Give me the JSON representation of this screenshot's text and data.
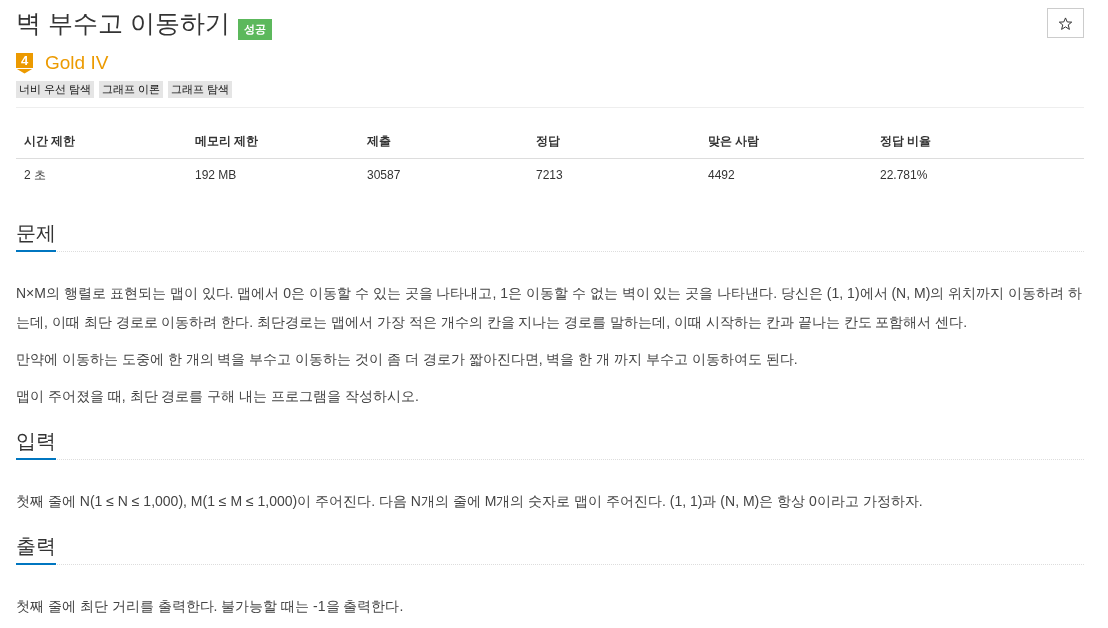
{
  "problem": {
    "title": "벽 부수고 이동하기",
    "result_badge": {
      "label": "성공",
      "kind": "success"
    },
    "favorite": {
      "starred": false
    },
    "tier": {
      "kind": "gold",
      "rank": "4",
      "name": "Gold IV"
    },
    "tags": [
      "너비 우선 탐색",
      "그래프 이론",
      "그래프 탐색"
    ]
  },
  "stats": {
    "columns": [
      "시간 제한",
      "메모리 제한",
      "제출",
      "정답",
      "맞은 사람",
      "정답 비율"
    ],
    "rows": [
      [
        "2 초",
        "192 MB",
        "30587",
        "7213",
        "4492",
        "22.781%"
      ]
    ]
  },
  "sections": [
    {
      "heading": "문제",
      "paragraphs": [
        "N×M의 행렬로 표현되는 맵이 있다. 맵에서 0은 이동할 수 있는 곳을 나타내고, 1은 이동할 수 없는 벽이 있는 곳을 나타낸다. 당신은 (1, 1)에서 (N, M)의 위치까지 이동하려 하는데, 이때 최단 경로로 이동하려 한다. 최단경로는 맵에서 가장 적은 개수의 칸을 지나는 경로를 말하는데, 이때 시작하는 칸과 끝나는 칸도 포함해서 센다.",
        "만약에 이동하는 도중에 한 개의 벽을 부수고 이동하는 것이 좀 더 경로가 짧아진다면, 벽을 한 개 까지 부수고 이동하여도 된다.",
        "맵이 주어졌을 때, 최단 경로를 구해 내는 프로그램을 작성하시오."
      ]
    },
    {
      "heading": "입력",
      "paragraphs": [
        "첫째 줄에 N(1 ≤ N ≤ 1,000), M(1 ≤ M ≤ 1,000)이 주어진다. 다음 N개의 줄에 M개의 숫자로 맵이 주어진다. (1, 1)과 (N, M)은 항상 0이라고 가정하자."
      ]
    },
    {
      "heading": "출력",
      "paragraphs": [
        "첫째 줄에 최단 거리를 출력한다. 불가능할 때는 -1을 출력한다."
      ]
    }
  ]
}
